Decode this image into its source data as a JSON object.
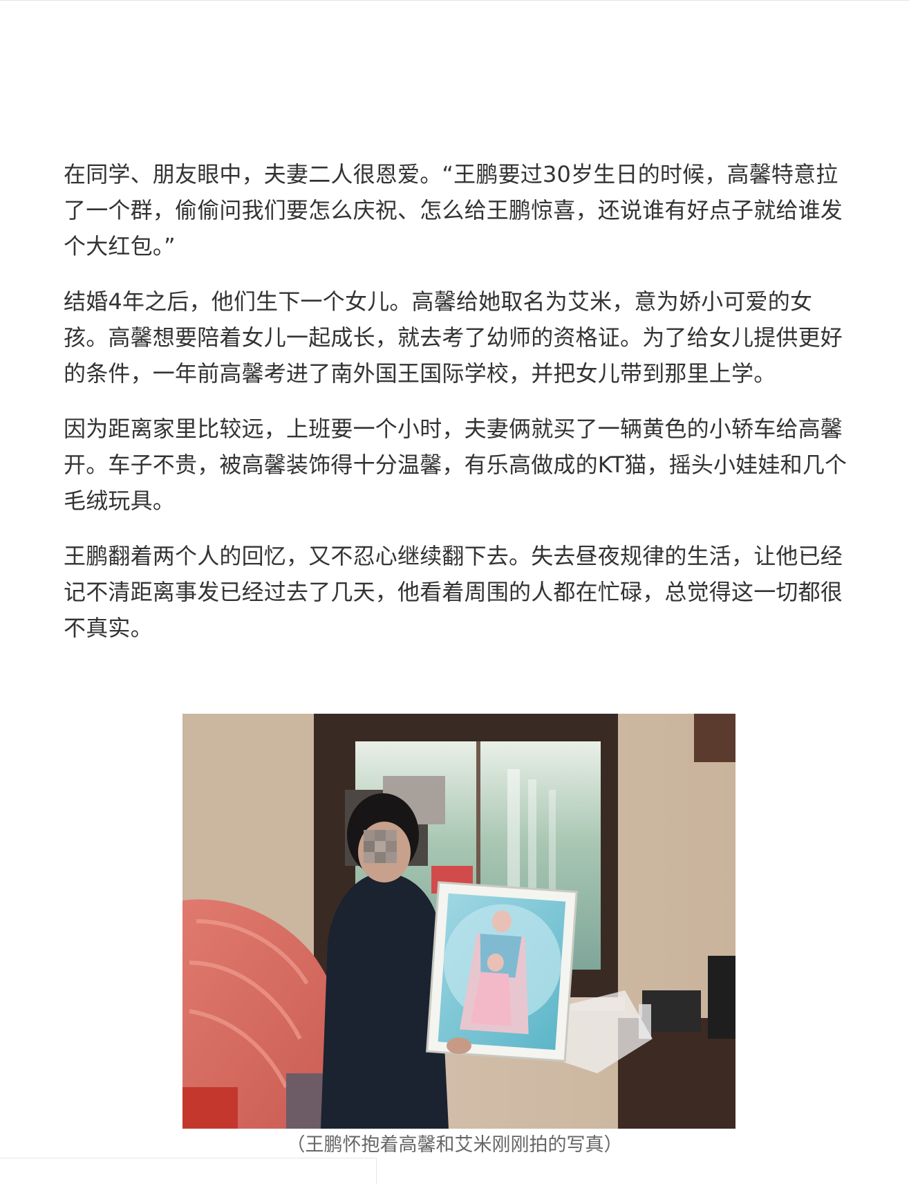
{
  "article": {
    "paragraphs": [
      "在同学、朋友眼中，夫妻二人很恩爱。“王鹏要过30岁生日的时候，高馨特意拉了一个群，偷偷问我们要怎么庆祝、怎么给王鹏惊喜，还说谁有好点子就给谁发个大红包。”",
      "结婚4年之后，他们生下一个女儿。高馨给她取名为艾米，意为娇小可爱的女孩。高馨想要陪着女儿一起成长，就去考了幼师的资格证。为了给女儿提供更好的条件，一年前高馨考进了南外国王国际学校，并把女儿带到那里上学。",
      "因为距离家里比较远，上班要一个小时，夫妻俩就买了一辆黄色的小轿车给高馨开。车子不贵，被高馨装饰得十分温馨，有乐高做成的KT猫，摇头小娃娃和几个毛绒玩具。",
      "王鹏翻着两个人的回忆，又不忍心继续翻下去。失去昼夜规律的生活，让他已经记不清距离事发已经过去了几天，他看着周围的人都在忙碌，总觉得这一切都很不真实。"
    ]
  },
  "figure": {
    "caption": "（王鹏怀抱着高馨和艾米刚刚拍的写真）"
  },
  "colors": {
    "text": "#333333",
    "caption": "#666666",
    "background": "#ffffff"
  }
}
